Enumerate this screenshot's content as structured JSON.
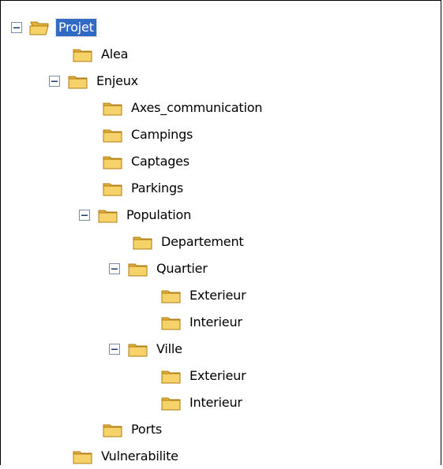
{
  "tree": {
    "root": {
      "label": "Projet",
      "selected": true
    },
    "alea": {
      "label": "Alea"
    },
    "enjeux": {
      "label": "Enjeux"
    },
    "axes": {
      "label": "Axes_communication"
    },
    "campings": {
      "label": "Campings"
    },
    "captages": {
      "label": "Captages"
    },
    "parkings": {
      "label": "Parkings"
    },
    "population": {
      "label": "Population"
    },
    "departement": {
      "label": "Departement"
    },
    "quartier": {
      "label": "Quartier"
    },
    "quartier_exterieur": {
      "label": "Exterieur"
    },
    "quartier_interieur": {
      "label": "Interieur"
    },
    "ville": {
      "label": "Ville"
    },
    "ville_exterieur": {
      "label": "Exterieur"
    },
    "ville_interieur": {
      "label": "Interieur"
    },
    "ports": {
      "label": "Ports"
    },
    "vulnerabilite": {
      "label": "Vulnerabilite"
    }
  },
  "colors": {
    "selection": "#316ac5",
    "folder_body": "#f6d26b",
    "folder_tab": "#e0b23c",
    "folder_outline": "#b07c12",
    "expander_border": "#7a8ea8"
  },
  "icons": {
    "expander": "minus-box-icon",
    "folder_closed": "folder-icon",
    "folder_open": "folder-open-icon"
  }
}
